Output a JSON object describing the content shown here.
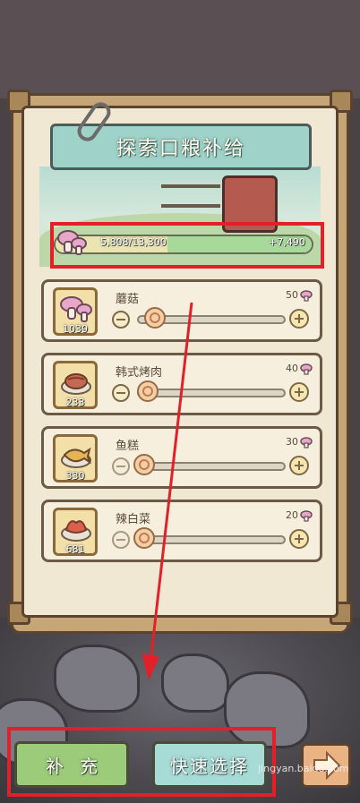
{
  "panel": {
    "title": "探索口粮补给",
    "progress": {
      "current_text": "5,808/13,300",
      "add_text": "+7,490",
      "current_fraction": 0.437,
      "after_fraction": 1.0
    }
  },
  "items": [
    {
      "name": "蘑菇",
      "count": "1039",
      "cost": "50",
      "icon": "mushroom-icon",
      "slider_fraction": 0.08,
      "minus_active": true
    },
    {
      "name": "韩式烤肉",
      "count": "233",
      "cost": "40",
      "icon": "bbq-meat-icon",
      "slider_fraction": 0.03,
      "minus_active": true
    },
    {
      "name": "鱼糕",
      "count": "330",
      "cost": "30",
      "icon": "fish-cake-icon",
      "slider_fraction": 0.0,
      "minus_active": false
    },
    {
      "name": "辣白菜",
      "count": "681",
      "cost": "20",
      "icon": "kimchi-icon",
      "slider_fraction": 0.0,
      "minus_active": false
    }
  ],
  "buttons": {
    "supply_label": "补充",
    "quick_select_label": "快速选择"
  },
  "watermark": "jingyan.baidu.com",
  "colors": {
    "highlight_box": "#e2202a",
    "supply_button": "#9ccc7a",
    "quick_button": "#a7dbd5"
  }
}
